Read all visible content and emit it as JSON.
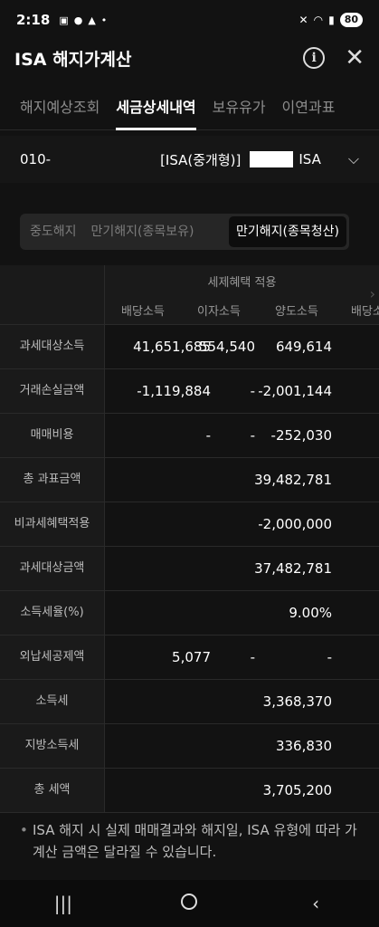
{
  "status": {
    "time": "2:18",
    "battery": "80"
  },
  "appbar": {
    "title": "ISA 해지가계산"
  },
  "tabs": [
    {
      "label": "해지예상조회"
    },
    {
      "label": "세금상세내역"
    },
    {
      "label": "보유유가"
    },
    {
      "label": "이연과표"
    }
  ],
  "account": {
    "number": "010-",
    "type_prefix": "[ISA(중개형)]",
    "type_suffix": "ISA"
  },
  "segments": [
    {
      "label": "중도해지"
    },
    {
      "label": "만기해지(종목보유)"
    },
    {
      "label": "만기해지(종목청산)"
    }
  ],
  "table": {
    "group_title": "세제혜택 적용",
    "columns": [
      "배당소득",
      "이자소득",
      "양도소득",
      "배당소"
    ],
    "rows": [
      {
        "label": "과세대상소득",
        "c1": "41,651,685",
        "c2": "554,540",
        "c3": "649,614"
      },
      {
        "label": "거래손실금액",
        "c1": "-1,119,884",
        "c2": "-",
        "c3": "-2,001,144"
      },
      {
        "label": "매매비용",
        "c1": "-",
        "c2": "-",
        "c3": "-252,030"
      },
      {
        "label": "총 과표금액",
        "total": "39,482,781"
      },
      {
        "label": "비과세혜택적용",
        "total": "-2,000,000"
      },
      {
        "label": "과세대상금액",
        "total": "37,482,781"
      },
      {
        "label": "소득세율(%)",
        "total": "9.00%"
      },
      {
        "label": "외납세공제액",
        "c1": "5,077",
        "c2": "-",
        "c3": "-"
      },
      {
        "label": "소득세",
        "total": "3,368,370"
      },
      {
        "label": "지방소득세",
        "total": "336,830"
      },
      {
        "label": "총 세액",
        "total": "3,705,200"
      }
    ]
  },
  "notes": [
    "ISA 해지 시 실제 매매결과와 해지일, ISA 유형에 따라 가계산 금액은 달라질 수 있습니다."
  ]
}
